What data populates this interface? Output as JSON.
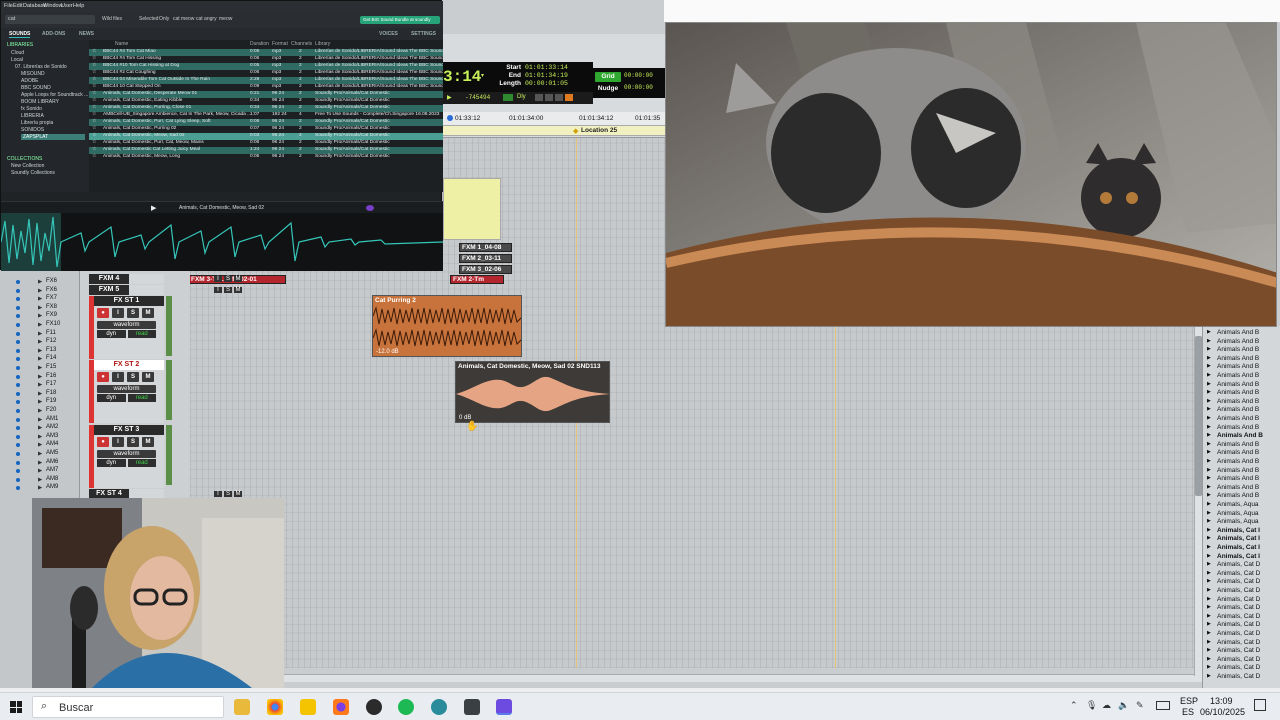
{
  "library": {
    "menu": [
      "File",
      "Edit",
      "Database",
      "Window",
      "User",
      "Help"
    ],
    "search_value": "cat",
    "filters": [
      "Wild files",
      "Selected",
      "Only",
      "cat meow",
      "cat angry",
      "meow"
    ],
    "promo": "Get BIG Sound Bundle at soundly",
    "tabs": [
      "SOUNDS",
      "ADD-ONS",
      "NEWS"
    ],
    "tabs_right": [
      "VOICES",
      "SETTINGS"
    ],
    "sidebar_heading": "LIBRARIES",
    "sidebar": [
      "Cloud",
      "Local",
      "07. Librerías de Sonido",
      "MISOUND",
      "ADOBE",
      "BBC SOUND",
      "Apple Loops for Soundtrack ...",
      "BOOM LIBRARY",
      "fx Sonido",
      "LIBRERIA",
      "Librería propia",
      "SONIDOS",
      "ZAPSPLAT"
    ],
    "collections_heading": "COLLECTIONS",
    "collections": [
      "New Collection",
      "Soundly Collections"
    ],
    "columns": [
      "Name",
      "Duration",
      "Format",
      "Channels",
      "Library"
    ],
    "rows": [
      {
        "name": "BBC44 #4 Tom Cat Miao",
        "dur": "0:05",
        "fmt": "mp3",
        "ch": "2",
        "lib": "Librerías de Sonido/LIBRERIA/Sound Ideas The BBC Sound"
      },
      {
        "name": "BBC44 #4 Tom Cat Hissing",
        "dur": "0:06",
        "fmt": "mp3",
        "ch": "2",
        "lib": "Librerías de Sonido/LIBRERIA/Sound Ideas The BBC Sound"
      },
      {
        "name": "BBC44 #10 Tom Cat Hissing at Dog",
        "dur": "0:05",
        "fmt": "mp3",
        "ch": "2",
        "lib": "Librerías de Sonido/LIBRERIA/Sound Ideas The BBC Sound"
      },
      {
        "name": "BBC44 #2 Cat Coughing",
        "dur": "0:06",
        "fmt": "mp3",
        "ch": "2",
        "lib": "Librerías de Sonido/LIBRERIA/Sound Ideas The BBC Sound"
      },
      {
        "name": "BBC44 04 Miserable Tom Cat Outside In The Rain",
        "dur": "2:28",
        "fmt": "mp3",
        "ch": "2",
        "lib": "Librerías de Sonido/LIBRERIA/Sound Ideas The BBC Sound"
      },
      {
        "name": "BBC44 10 Cat Stepped On",
        "dur": "0:09",
        "fmt": "mp3",
        "ch": "2",
        "lib": "Librerías de Sonido/LIBRERIA/Sound Ideas The BBC Sound Effe"
      },
      {
        "name": "Animals, Cat Domestic, Desperate Meow 01",
        "dur": "0:21",
        "fmt": "96 24",
        "ch": "2",
        "lib": "Soundly Pro/Animals/Cat Domestic"
      },
      {
        "name": "Animals, Cat Domestic, Eating Kibble",
        "dur": "0:34",
        "fmt": "96 24",
        "ch": "2",
        "lib": "Soundly Pro/Animals/Cat Domestic"
      },
      {
        "name": "Animals, Cat Domestic, Purring, Close 01",
        "dur": "0:34",
        "fmt": "96 24",
        "ch": "2",
        "lib": "Soundly Pro/Animals/Cat Domestic"
      },
      {
        "name": "AMBCell-UB_Singapore Ambience, Cat In The Park, Meow, Cicada ...",
        "dur": "1:07",
        "fmt": "192 24",
        "ch": "4",
        "lib": "Free To Use Sounds - Complete/Ch.Singapore 16.08.2023"
      },
      {
        "name": "Animals, Cat Domestic, Purr, Cat Lying Sleep, Soft",
        "dur": "0:06",
        "fmt": "96 24",
        "ch": "2",
        "lib": "Soundly Pro/Animals/Cat Domestic"
      },
      {
        "name": "Animals, Cat Domestic, Purring 02",
        "dur": "0:07",
        "fmt": "96 24",
        "ch": "2",
        "lib": "Soundly Pro/Animals/Cat Domestic"
      },
      {
        "name": "Animals, Cat Domestic, Meow, Sad 02",
        "dur": "0:03",
        "fmt": "96 24",
        "ch": "2",
        "lib": "Soundly Pro/Animals/Cat Domestic"
      },
      {
        "name": "Animals, Cat Domestic, Purr, Cat, Meow, Mains",
        "dur": "0:06",
        "fmt": "96 24",
        "ch": "2",
        "lib": "Soundly Pro/Animals/Cat Domestic"
      },
      {
        "name": "Animals, Cat Domestic Cat Letting Juicy Meal",
        "dur": "1:24",
        "fmt": "96 24",
        "ch": "2",
        "lib": "Soundly Pro/Animals/Cat Domestic"
      },
      {
        "name": "Animals, Cat Domestic, Meow, Long",
        "dur": "0:05",
        "fmt": "96 24",
        "ch": "2",
        "lib": "Soundly Pro/Animals/Cat Domestic"
      }
    ],
    "player_title": "Animals, Cat Domestic, Meow, Sad 02"
  },
  "protools": {
    "counter_main": "3:14",
    "start_label": "Start",
    "start": "01:01:33:14",
    "end_label": "End",
    "end": "01:01:34:19",
    "length_label": "Length",
    "length": "00:00:01:05",
    "grid_label": "Grid",
    "grid_value": "00:00:00",
    "nudge_label": "Nudge",
    "nudge_value": "00:00:00",
    "small_counter": "-745494",
    "dly": "Dly",
    "timeline": [
      "01:33:12",
      "01:01:34:00",
      "01:01:34:12",
      "01:01:35"
    ],
    "location": "Location 25",
    "tracks": [
      "FX6",
      "FX6",
      "FX7",
      "FX8",
      "FX9",
      "FX10",
      "F11",
      "F12",
      "F13",
      "F14",
      "F15",
      "F16",
      "F17",
      "F18",
      "F19",
      "F20",
      "AM1",
      "AM2",
      "AM3",
      "AM4",
      "AM5",
      "AM6",
      "AM7",
      "AM8",
      "AM9"
    ],
    "strips": [
      {
        "name": "FXM 4",
        "buttons": [
          "I",
          "S",
          "M"
        ]
      },
      {
        "name": "FXM 5",
        "buttons": [
          "I",
          "S",
          "M"
        ]
      },
      {
        "name": "FX ST 1",
        "buttons": [
          "I",
          "S",
          "M"
        ],
        "view": "waveform",
        "dyn": "dyn",
        "mode": "read"
      },
      {
        "name": "FX ST 2",
        "buttons": [
          "I",
          "S",
          "M"
        ],
        "view": "waveform",
        "dyn": "dyn",
        "mode": "read"
      },
      {
        "name": "FX ST 3",
        "buttons": [
          "I",
          "S",
          "M"
        ],
        "view": "waveform",
        "dyn": "dyn",
        "mode": "read"
      },
      {
        "name": "FX ST 4",
        "buttons": [
          "I",
          "S",
          "M"
        ]
      }
    ],
    "clips": {
      "fxm_1": "FXM 1_04-08",
      "fxm_2": "FXM 2_03-11",
      "fxm_3": "FXM 3_02-06",
      "fxm_2b": "FXM 2-Tm",
      "fxm_3b": "FXM 3-Tm.Shft_02-01",
      "purring": "Cat Purring 2",
      "purring_gain": "-12.0 dB",
      "meow": "Animals, Cat Domestic, Meow, Sad 02 SND113",
      "meow_gain": "0 dB"
    },
    "right_list": [
      {
        "t": "Animals And B",
        "b": false
      },
      {
        "t": "Animals And B",
        "b": false
      },
      {
        "t": "Animals And B",
        "b": false
      },
      {
        "t": "Animals And B",
        "b": false
      },
      {
        "t": "Animals And B",
        "b": false
      },
      {
        "t": "Animals And B",
        "b": false
      },
      {
        "t": "Animals And B",
        "b": false
      },
      {
        "t": "Animals And B",
        "b": false
      },
      {
        "t": "Animals And B",
        "b": false
      },
      {
        "t": "Animals And B",
        "b": false
      },
      {
        "t": "Animals And B",
        "b": false
      },
      {
        "t": "Animals And B",
        "b": false
      },
      {
        "t": "Animals And B",
        "b": true
      },
      {
        "t": "Animals And B",
        "b": false
      },
      {
        "t": "Animals And B",
        "b": false
      },
      {
        "t": "Animals And B",
        "b": false
      },
      {
        "t": "Animals And B",
        "b": false
      },
      {
        "t": "Animals And B",
        "b": false
      },
      {
        "t": "Animals And B",
        "b": false
      },
      {
        "t": "Animals And B",
        "b": false
      },
      {
        "t": "Animals, Aqua",
        "b": false
      },
      {
        "t": "Animals, Aqua",
        "b": false
      },
      {
        "t": "Animals, Aqua",
        "b": false
      },
      {
        "t": "Animals, Cat I",
        "b": true
      },
      {
        "t": "Animals, Cat I",
        "b": true
      },
      {
        "t": "Animals, Cat I",
        "b": true
      },
      {
        "t": "Animals, Cat I",
        "b": true
      },
      {
        "t": "Animals, Cat D",
        "b": false
      },
      {
        "t": "Animals, Cat D",
        "b": false
      },
      {
        "t": "Animals, Cat D",
        "b": false
      },
      {
        "t": "Animals, Cat D",
        "b": false
      },
      {
        "t": "Animals, Cat D",
        "b": false
      },
      {
        "t": "Animals, Cat D",
        "b": false
      },
      {
        "t": "Animals, Cat D",
        "b": false
      },
      {
        "t": "Animals, Cat D",
        "b": false
      },
      {
        "t": "Animals, Cat D",
        "b": false
      },
      {
        "t": "Animals, Cat D",
        "b": false
      },
      {
        "t": "Animals, Cat D",
        "b": false
      },
      {
        "t": "Animals, Cat D",
        "b": false
      },
      {
        "t": "Animals, Cat D",
        "b": false
      },
      {
        "t": "Animals, Cat D",
        "b": false
      }
    ]
  },
  "taskbar": {
    "search_placeholder": "Buscar",
    "lang_top": "ESP",
    "lang_bottom": "ES",
    "time": "13:09",
    "date": "06/10/2025"
  },
  "colors": {
    "accent_green": "#c8f05a",
    "library_teal": "#3b7f78",
    "clip_orange": "#c8733c",
    "clip_peach": "#e5a585"
  }
}
